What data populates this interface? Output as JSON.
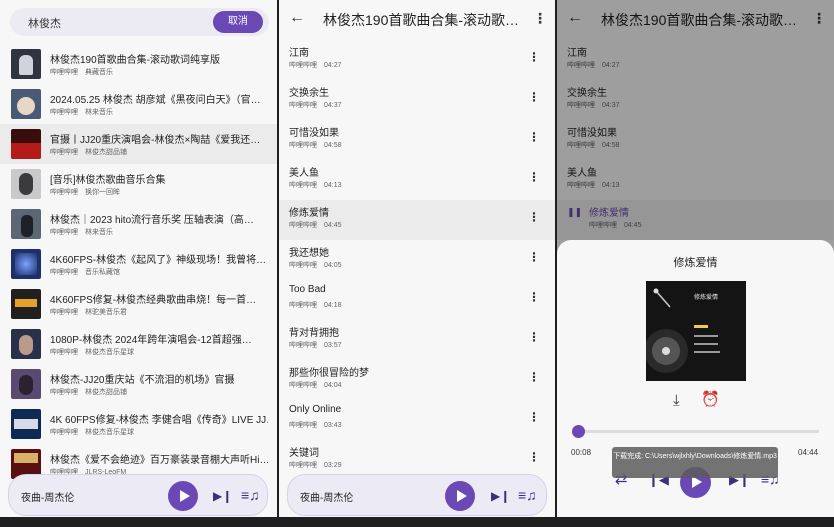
{
  "search": {
    "query": "林俊杰",
    "cancel_label": "取消",
    "results": [
      {
        "title": "林俊杰190首歌曲合集-滚动歌词纯享版",
        "platform": "哔哩哔哩",
        "uploader": "典藏音乐"
      },
      {
        "title": "2024.05.25 林俊杰 胡彦斌《黑夜问白天》（官…",
        "platform": "哔哩哔哩",
        "uploader": "林来音乐"
      },
      {
        "title": "官摄丨JJ20重庆演唱会-林俊杰×陶喆《爱我还…",
        "platform": "哔哩哔哩",
        "uploader": "林俊杰甜品铺"
      },
      {
        "title": "[音乐]林俊杰歌曲音乐合集",
        "platform": "哔哩哔哩",
        "uploader": "换你一回眸"
      },
      {
        "title": "林俊杰｜2023 hito流行音乐奖 压轴表演（高…",
        "platform": "哔哩哔哩",
        "uploader": "林来音乐"
      },
      {
        "title": "4K60FPS-林俊杰《起风了》神级现场！我曾将…",
        "platform": "哔哩哔哩",
        "uploader": "音乐私藏馆"
      },
      {
        "title": "4K60FPS修复-林俊杰经典歌曲串烧！每一首…",
        "platform": "哔哩哔哩",
        "uploader": "林驼美音乐君"
      },
      {
        "title": "1080P-林俊杰 2024年跨年演唱会-12首超强…",
        "platform": "哔哩哔哩",
        "uploader": "林俊杰音乐星球"
      },
      {
        "title": "林俊杰-JJ20重庆站《不流泪的机场》官摄",
        "platform": "哔哩哔哩",
        "uploader": "林俊杰甜品铺"
      },
      {
        "title": "4K 60FPS修复-林俊杰 李健合唱《传奇》LIVE JJ…",
        "platform": "哔哩哔哩",
        "uploader": "林俊杰音乐星球"
      },
      {
        "title": "林俊杰《爱不会绝迹》百万豪装录音棚大声听Hi…",
        "platform": "哔哩哔哩",
        "uploader": "JLRS-LeoFM"
      }
    ]
  },
  "mini_player": {
    "song": "夜曲-周杰伦"
  },
  "album": {
    "title": "林俊杰190首歌曲合集-滚动歌…",
    "tracks": [
      {
        "title": "江南",
        "platform": "哔哩哔哩",
        "duration": "04:27"
      },
      {
        "title": "交换余生",
        "platform": "哔哩哔哩",
        "duration": "04:37"
      },
      {
        "title": "可惜没如果",
        "platform": "哔哩哔哩",
        "duration": "04:58"
      },
      {
        "title": "美人鱼",
        "platform": "哔哩哔哩",
        "duration": "04:13"
      },
      {
        "title": "修炼爱情",
        "platform": "哔哩哔哩",
        "duration": "04:45"
      },
      {
        "title": "我还想她",
        "platform": "哔哩哔哩",
        "duration": "04:05"
      },
      {
        "title": "Too Bad",
        "platform": "哔哩哔哩",
        "duration": "04:18"
      },
      {
        "title": "背对背拥抱",
        "platform": "哔哩哔哩",
        "duration": "03:57"
      },
      {
        "title": "那些你很冒险的梦",
        "platform": "哔哩哔哩",
        "duration": "04:04"
      },
      {
        "title": "Only Online",
        "platform": "哔哩哔哩",
        "duration": "03:43"
      },
      {
        "title": "关键词",
        "platform": "哔哩哔哩",
        "duration": "03:29"
      }
    ]
  },
  "now_playing": {
    "title": "修炼爱情",
    "art_title": "修炼爱情",
    "current_time": "00:08",
    "total_time": "04:44",
    "progress": 0.03,
    "toast": "下载完成: C:\\Users\\wjlxhly\\Downloads\\修炼爱情.mp3"
  },
  "colors": {
    "accent": "#6a48b5",
    "background": "#f7f7f8",
    "highlight_row": "#ebebeb"
  }
}
